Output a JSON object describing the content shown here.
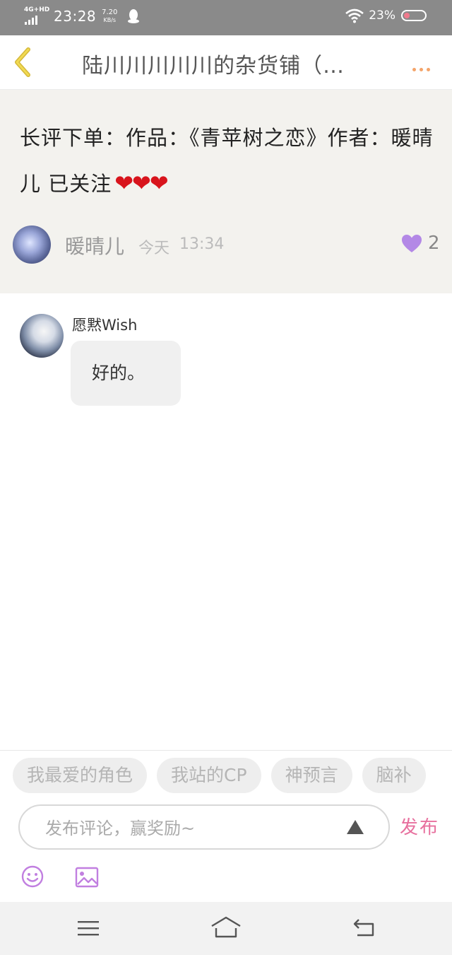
{
  "status_bar": {
    "network": "4G+HD",
    "time": "23:28",
    "speed_value": "7.20",
    "speed_unit": "KB/s",
    "battery_percent": "23%",
    "battery_level": 0.23
  },
  "header": {
    "title": "陆川川川川川的杂货铺（…",
    "back_icon": "chevron-left-icon",
    "more_icon": "more-dots-icon"
  },
  "post": {
    "text": "长评下单：作品：《青苹树之恋》作者：暖晴儿 已关注",
    "hearts": "❤❤❤",
    "author": "暖晴儿",
    "day": "今天",
    "time": "13:34",
    "like_count": "2",
    "colors": {
      "background": "#f3f2ee",
      "like": "#b388e6",
      "heart": "#d8141c"
    }
  },
  "comments": [
    {
      "author": "愿黙Wish",
      "text": "好的。"
    }
  ],
  "composer": {
    "tags": [
      "我最爱的角色",
      "我站的CP",
      "神预言",
      "脑补"
    ],
    "placeholder": "发布评论，赢奖励~",
    "value": "",
    "send_label": "发布",
    "colors": {
      "send": "#e7709e",
      "icons": "#c17fe0"
    }
  },
  "nav_bar": {
    "icons": [
      "menu-icon",
      "home-icon",
      "return-icon"
    ]
  }
}
